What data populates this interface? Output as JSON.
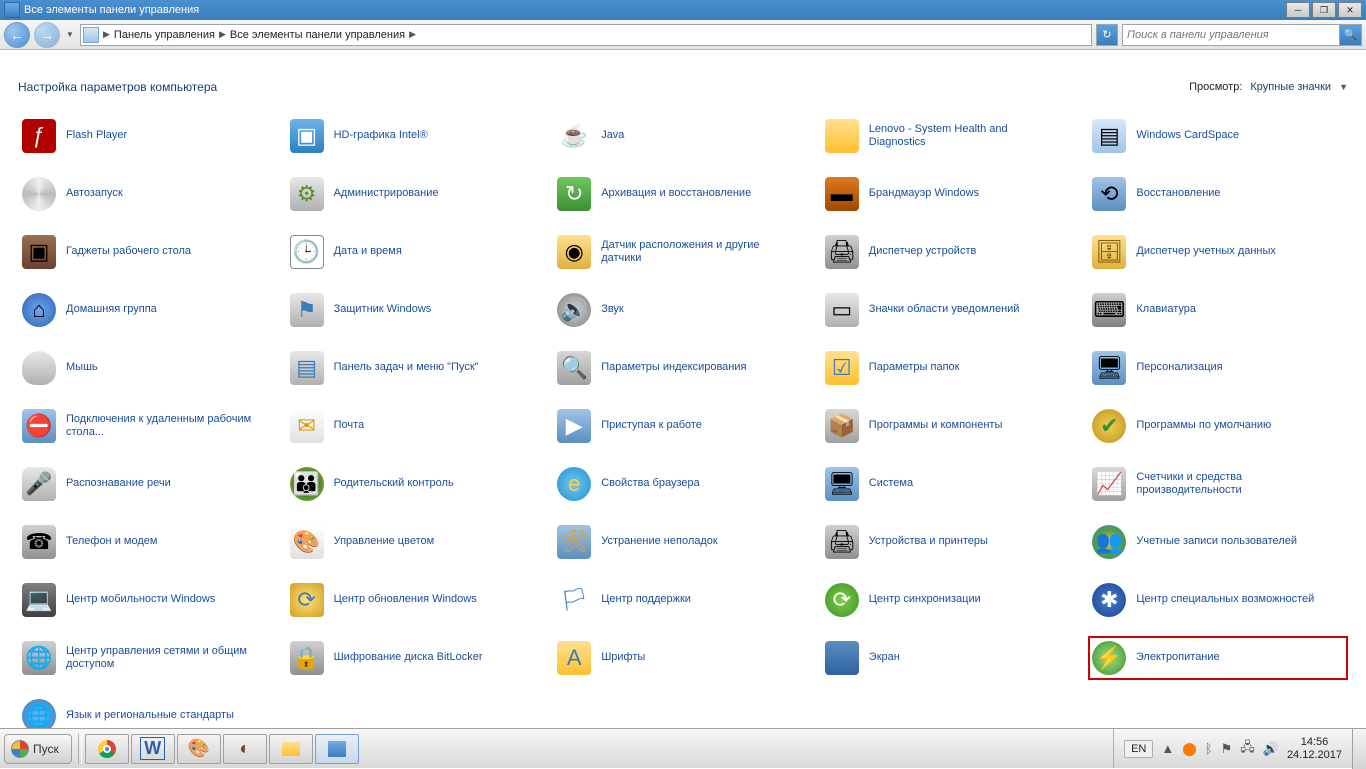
{
  "window": {
    "title": "Все элементы панели управления"
  },
  "nav": {
    "breadcrumb": [
      "Панель управления",
      "Все элементы панели управления"
    ]
  },
  "search": {
    "placeholder": "Поиск в панели управления"
  },
  "header": {
    "heading": "Настройка параметров компьютера",
    "view_label": "Просмотр:",
    "view_value": "Крупные значки"
  },
  "items": [
    {
      "label": "Flash Player",
      "icon": "ic-flash",
      "glyph": "ƒ"
    },
    {
      "label": "HD-графика Intel®",
      "icon": "ic-intel",
      "glyph": "▣"
    },
    {
      "label": "Java",
      "icon": "ic-java",
      "glyph": "☕"
    },
    {
      "label": "Lenovo - System Health and Diagnostics",
      "icon": "ic-folder",
      "glyph": ""
    },
    {
      "label": "Windows CardSpace",
      "icon": "ic-card",
      "glyph": "▤"
    },
    {
      "label": "Автозапуск",
      "icon": "ic-disc",
      "glyph": ""
    },
    {
      "label": "Администрирование",
      "icon": "ic-admin",
      "glyph": "⚙"
    },
    {
      "label": "Архивация и восстановление",
      "icon": "ic-backup",
      "glyph": "↻"
    },
    {
      "label": "Брандмауэр Windows",
      "icon": "ic-fire",
      "glyph": "▬"
    },
    {
      "label": "Восстановление",
      "icon": "ic-recover",
      "glyph": "⟲"
    },
    {
      "label": "Гаджеты рабочего стола",
      "icon": "ic-gadget",
      "glyph": "▣"
    },
    {
      "label": "Дата и время",
      "icon": "ic-date",
      "glyph": "🕒"
    },
    {
      "label": "Датчик расположения и другие датчики",
      "icon": "ic-sensor",
      "glyph": "◉"
    },
    {
      "label": "Диспетчер устройств",
      "icon": "ic-devmgr",
      "glyph": "🖨"
    },
    {
      "label": "Диспетчер учетных данных",
      "icon": "ic-cred",
      "glyph": "🗄"
    },
    {
      "label": "Домашняя группа",
      "icon": "ic-home",
      "glyph": "⌂"
    },
    {
      "label": "Защитник Windows",
      "icon": "ic-defend",
      "glyph": "⚑"
    },
    {
      "label": "Звук",
      "icon": "ic-sound",
      "glyph": "🔊"
    },
    {
      "label": "Значки области уведомлений",
      "icon": "ic-tray",
      "glyph": "▭"
    },
    {
      "label": "Клавиатура",
      "icon": "ic-kbd",
      "glyph": "⌨"
    },
    {
      "label": "Мышь",
      "icon": "ic-mouse",
      "glyph": ""
    },
    {
      "label": "Панель задач и меню \"Пуск\"",
      "icon": "ic-taskbar",
      "glyph": "▤"
    },
    {
      "label": "Параметры индексирования",
      "icon": "ic-index",
      "glyph": "🔍"
    },
    {
      "label": "Параметры папок",
      "icon": "ic-foldopt",
      "glyph": "☑"
    },
    {
      "label": "Персонализация",
      "icon": "ic-person",
      "glyph": "🖥"
    },
    {
      "label": "Подключения к удаленным рабочим стола...",
      "icon": "ic-rdp",
      "glyph": "⛔"
    },
    {
      "label": "Почта",
      "icon": "ic-mail",
      "glyph": "✉"
    },
    {
      "label": "Приступая к работе",
      "icon": "ic-start",
      "glyph": "▶"
    },
    {
      "label": "Программы и компоненты",
      "icon": "ic-prog",
      "glyph": "📦"
    },
    {
      "label": "Программы по умолчанию",
      "icon": "ic-default",
      "glyph": "✔"
    },
    {
      "label": "Распознавание речи",
      "icon": "ic-mic",
      "glyph": "🎤"
    },
    {
      "label": "Родительский контроль",
      "icon": "ic-parent",
      "glyph": "👪"
    },
    {
      "label": "Свойства браузера",
      "icon": "ic-ie",
      "glyph": "e"
    },
    {
      "label": "Система",
      "icon": "ic-system",
      "glyph": "🖥"
    },
    {
      "label": "Счетчики и средства производительности",
      "icon": "ic-perf",
      "glyph": "📈"
    },
    {
      "label": "Телефон и модем",
      "icon": "ic-phone",
      "glyph": "☎"
    },
    {
      "label": "Управление цветом",
      "icon": "ic-color",
      "glyph": "🎨"
    },
    {
      "label": "Устранение неполадок",
      "icon": "ic-trouble",
      "glyph": "🛠"
    },
    {
      "label": "Устройства и принтеры",
      "icon": "ic-devprn",
      "glyph": "🖨"
    },
    {
      "label": "Учетные записи пользователей",
      "icon": "ic-users",
      "glyph": "👥"
    },
    {
      "label": "Центр мобильности Windows",
      "icon": "ic-mobile",
      "glyph": "💻"
    },
    {
      "label": "Центр обновления Windows",
      "icon": "ic-update",
      "glyph": "⟳"
    },
    {
      "label": "Центр поддержки",
      "icon": "ic-flag",
      "glyph": "🏳"
    },
    {
      "label": "Центр синхронизации",
      "icon": "ic-sync",
      "glyph": "⟳"
    },
    {
      "label": "Центр специальных возможностей",
      "icon": "ic-ease",
      "glyph": "✱"
    },
    {
      "label": "Центр управления сетями и общим доступом",
      "icon": "ic-net",
      "glyph": "🌐"
    },
    {
      "label": "Шифрование диска BitLocker",
      "icon": "ic-bitlk",
      "glyph": "🔒"
    },
    {
      "label": "Шрифты",
      "icon": "ic-font",
      "glyph": "A"
    },
    {
      "label": "Экран",
      "icon": "ic-screen",
      "glyph": ""
    },
    {
      "label": "Электропитание",
      "icon": "ic-power",
      "glyph": "⚡",
      "highlight": true
    },
    {
      "label": "Язык и региональные стандарты",
      "icon": "ic-region",
      "glyph": "🌐"
    }
  ],
  "taskbar": {
    "start_label": "Пуск",
    "lang": "EN",
    "time": "14:56",
    "date": "24.12.2017"
  }
}
